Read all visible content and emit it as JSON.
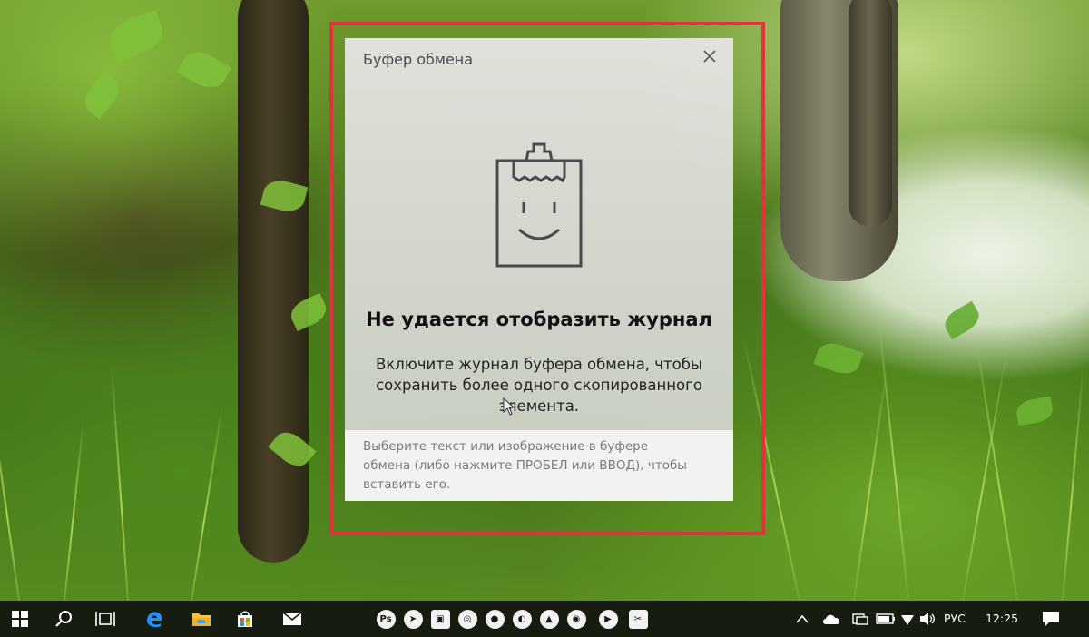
{
  "clipboard_panel": {
    "title": "Буфер обмена",
    "heading": "Не удается отобразить журнал",
    "body": "Включите журнал буфера обмена, чтобы сохранить более одного скопированного элемента.",
    "hint": "Выберите текст или изображение в буфере обмена (либо нажмите ПРОБЕЛ или ВВОД), чтобы вставить его.",
    "highlight_color": "#e0333d"
  },
  "taskbar": {
    "pinned": [
      "start-button",
      "search-icon",
      "task-view-icon",
      "edge-icon",
      "file-explorer-icon",
      "store-icon",
      "mail-icon"
    ],
    "running_apps": [
      {
        "name": "photoshop-icon",
        "glyph": "Ps"
      },
      {
        "name": "telegram-icon",
        "glyph": "➤"
      },
      {
        "name": "photos-icon",
        "glyph": "▣"
      },
      {
        "name": "chrome-icon",
        "glyph": "◎"
      },
      {
        "name": "firefox-icon",
        "glyph": "●"
      },
      {
        "name": "app-icon",
        "glyph": "◐"
      },
      {
        "name": "vlc-icon",
        "glyph": "▲"
      },
      {
        "name": "obs-icon",
        "glyph": "◉"
      },
      {
        "name": "media-player-icon",
        "glyph": "▶"
      },
      {
        "name": "snipping-tool-icon",
        "glyph": "✂"
      }
    ],
    "tray": {
      "language": "РУС",
      "time": "12:25"
    }
  }
}
